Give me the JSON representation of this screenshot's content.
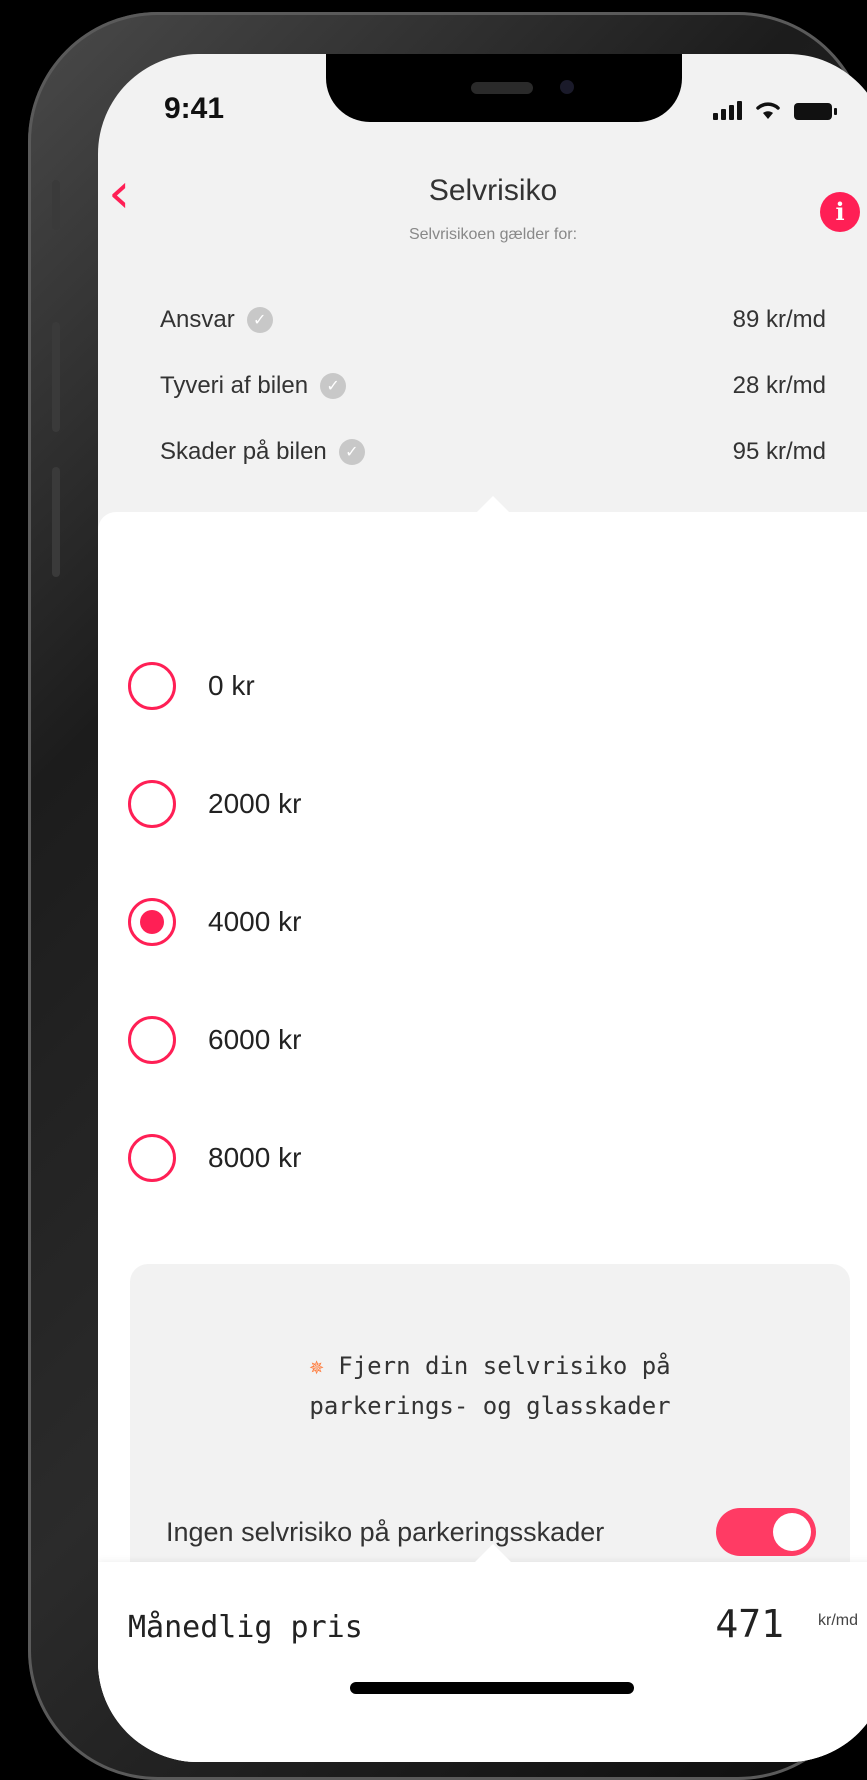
{
  "status_bar": {
    "time": "9:41"
  },
  "header": {
    "title": "Selvrisiko",
    "subtitle": "Selvrisikoen gælder for:"
  },
  "coverage": [
    {
      "label": "Ansvar",
      "price": "89 kr/md"
    },
    {
      "label": "Tyveri af bilen",
      "price": "28 kr/md"
    },
    {
      "label": "Skader på bilen",
      "price": "95 kr/md"
    }
  ],
  "options": [
    {
      "label": "0 kr",
      "selected": false
    },
    {
      "label": "2000 kr",
      "selected": false
    },
    {
      "label": "4000 kr",
      "selected": true
    },
    {
      "label": "6000 kr",
      "selected": false
    },
    {
      "label": "8000 kr",
      "selected": false
    }
  ],
  "promo": {
    "icon": "spark-icon",
    "line1": "Fjern din selvrisiko på",
    "line2": "parkerings- og glasskader",
    "toggle_label": "Ingen selvrisiko på parkeringsskader",
    "toggle_on": true
  },
  "footer": {
    "price_label": "Månedlig pris",
    "price_value": "471",
    "price_unit": "kr/md"
  },
  "colors": {
    "accent": "#ff1f55",
    "background": "#f2f2f2",
    "sheet": "#ffffff"
  }
}
